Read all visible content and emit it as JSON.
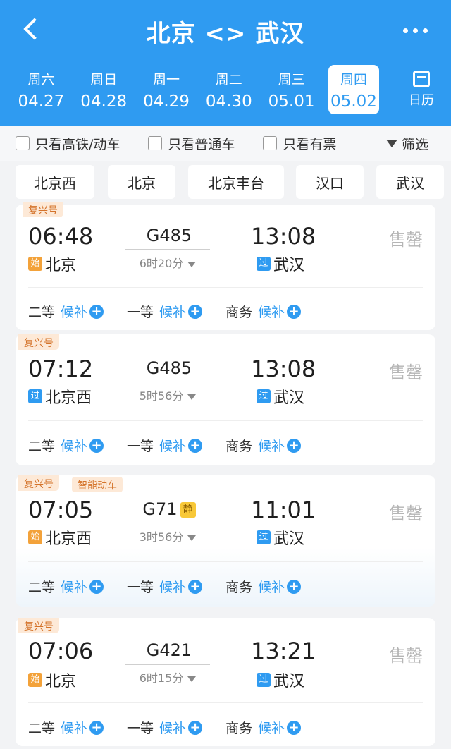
{
  "header": {
    "title": "北京 <> 武汉"
  },
  "dates": [
    {
      "weekday": "周六",
      "date": "04.27"
    },
    {
      "weekday": "周日",
      "date": "04.28"
    },
    {
      "weekday": "周一",
      "date": "04.29"
    },
    {
      "weekday": "周二",
      "date": "04.30"
    },
    {
      "weekday": "周三",
      "date": "05.01"
    },
    {
      "weekday": "周四",
      "date": "05.02"
    }
  ],
  "calendar_label": "日历",
  "filters": {
    "gaotie": "只看高铁/动车",
    "putong": "只看普通车",
    "youpiao": "只看有票",
    "screen": "筛选"
  },
  "stations": [
    "北京西",
    "北京",
    "北京丰台",
    "汉口",
    "武汉"
  ],
  "trains": [
    {
      "tag": "复兴号",
      "dep_time": "06:48",
      "train_no": "G485",
      "duration": "6时20分",
      "arr_time": "13:08",
      "status": "售罄",
      "dep_badge": "始",
      "dep_station": "北京",
      "arr_badge": "过",
      "arr_station": "武汉",
      "seats": [
        {
          "cls": "二等",
          "wait": "候补"
        },
        {
          "cls": "一等",
          "wait": "候补"
        },
        {
          "cls": "商务",
          "wait": "候补"
        }
      ]
    },
    {
      "tag": "复兴号",
      "dep_time": "07:12",
      "train_no": "G485",
      "duration": "5时56分",
      "arr_time": "13:08",
      "status": "售罄",
      "dep_badge": "过",
      "dep_station": "北京西",
      "arr_badge": "过",
      "arr_station": "武汉",
      "seats": [
        {
          "cls": "二等",
          "wait": "候补"
        },
        {
          "cls": "一等",
          "wait": "候补"
        },
        {
          "cls": "商务",
          "wait": "候补"
        }
      ]
    },
    {
      "tag": "复兴号",
      "tag2": "智能动车",
      "dep_time": "07:05",
      "train_no": "G71",
      "quiet": "静",
      "duration": "3时56分",
      "arr_time": "11:01",
      "status": "售罄",
      "dep_badge": "始",
      "dep_station": "北京西",
      "arr_badge": "过",
      "arr_station": "武汉",
      "seats": [
        {
          "cls": "二等",
          "wait": "候补"
        },
        {
          "cls": "一等",
          "wait": "候补"
        },
        {
          "cls": "商务",
          "wait": "候补"
        }
      ]
    },
    {
      "tag": "复兴号",
      "dep_time": "07:06",
      "train_no": "G421",
      "duration": "6时15分",
      "arr_time": "13:21",
      "status": "售罄",
      "dep_badge": "始",
      "dep_station": "北京",
      "arr_badge": "过",
      "arr_station": "武汉",
      "seats": [
        {
          "cls": "二等",
          "wait": "候补"
        },
        {
          "cls": "一等",
          "wait": "候补"
        },
        {
          "cls": "商务",
          "wait": "候补"
        }
      ]
    }
  ]
}
